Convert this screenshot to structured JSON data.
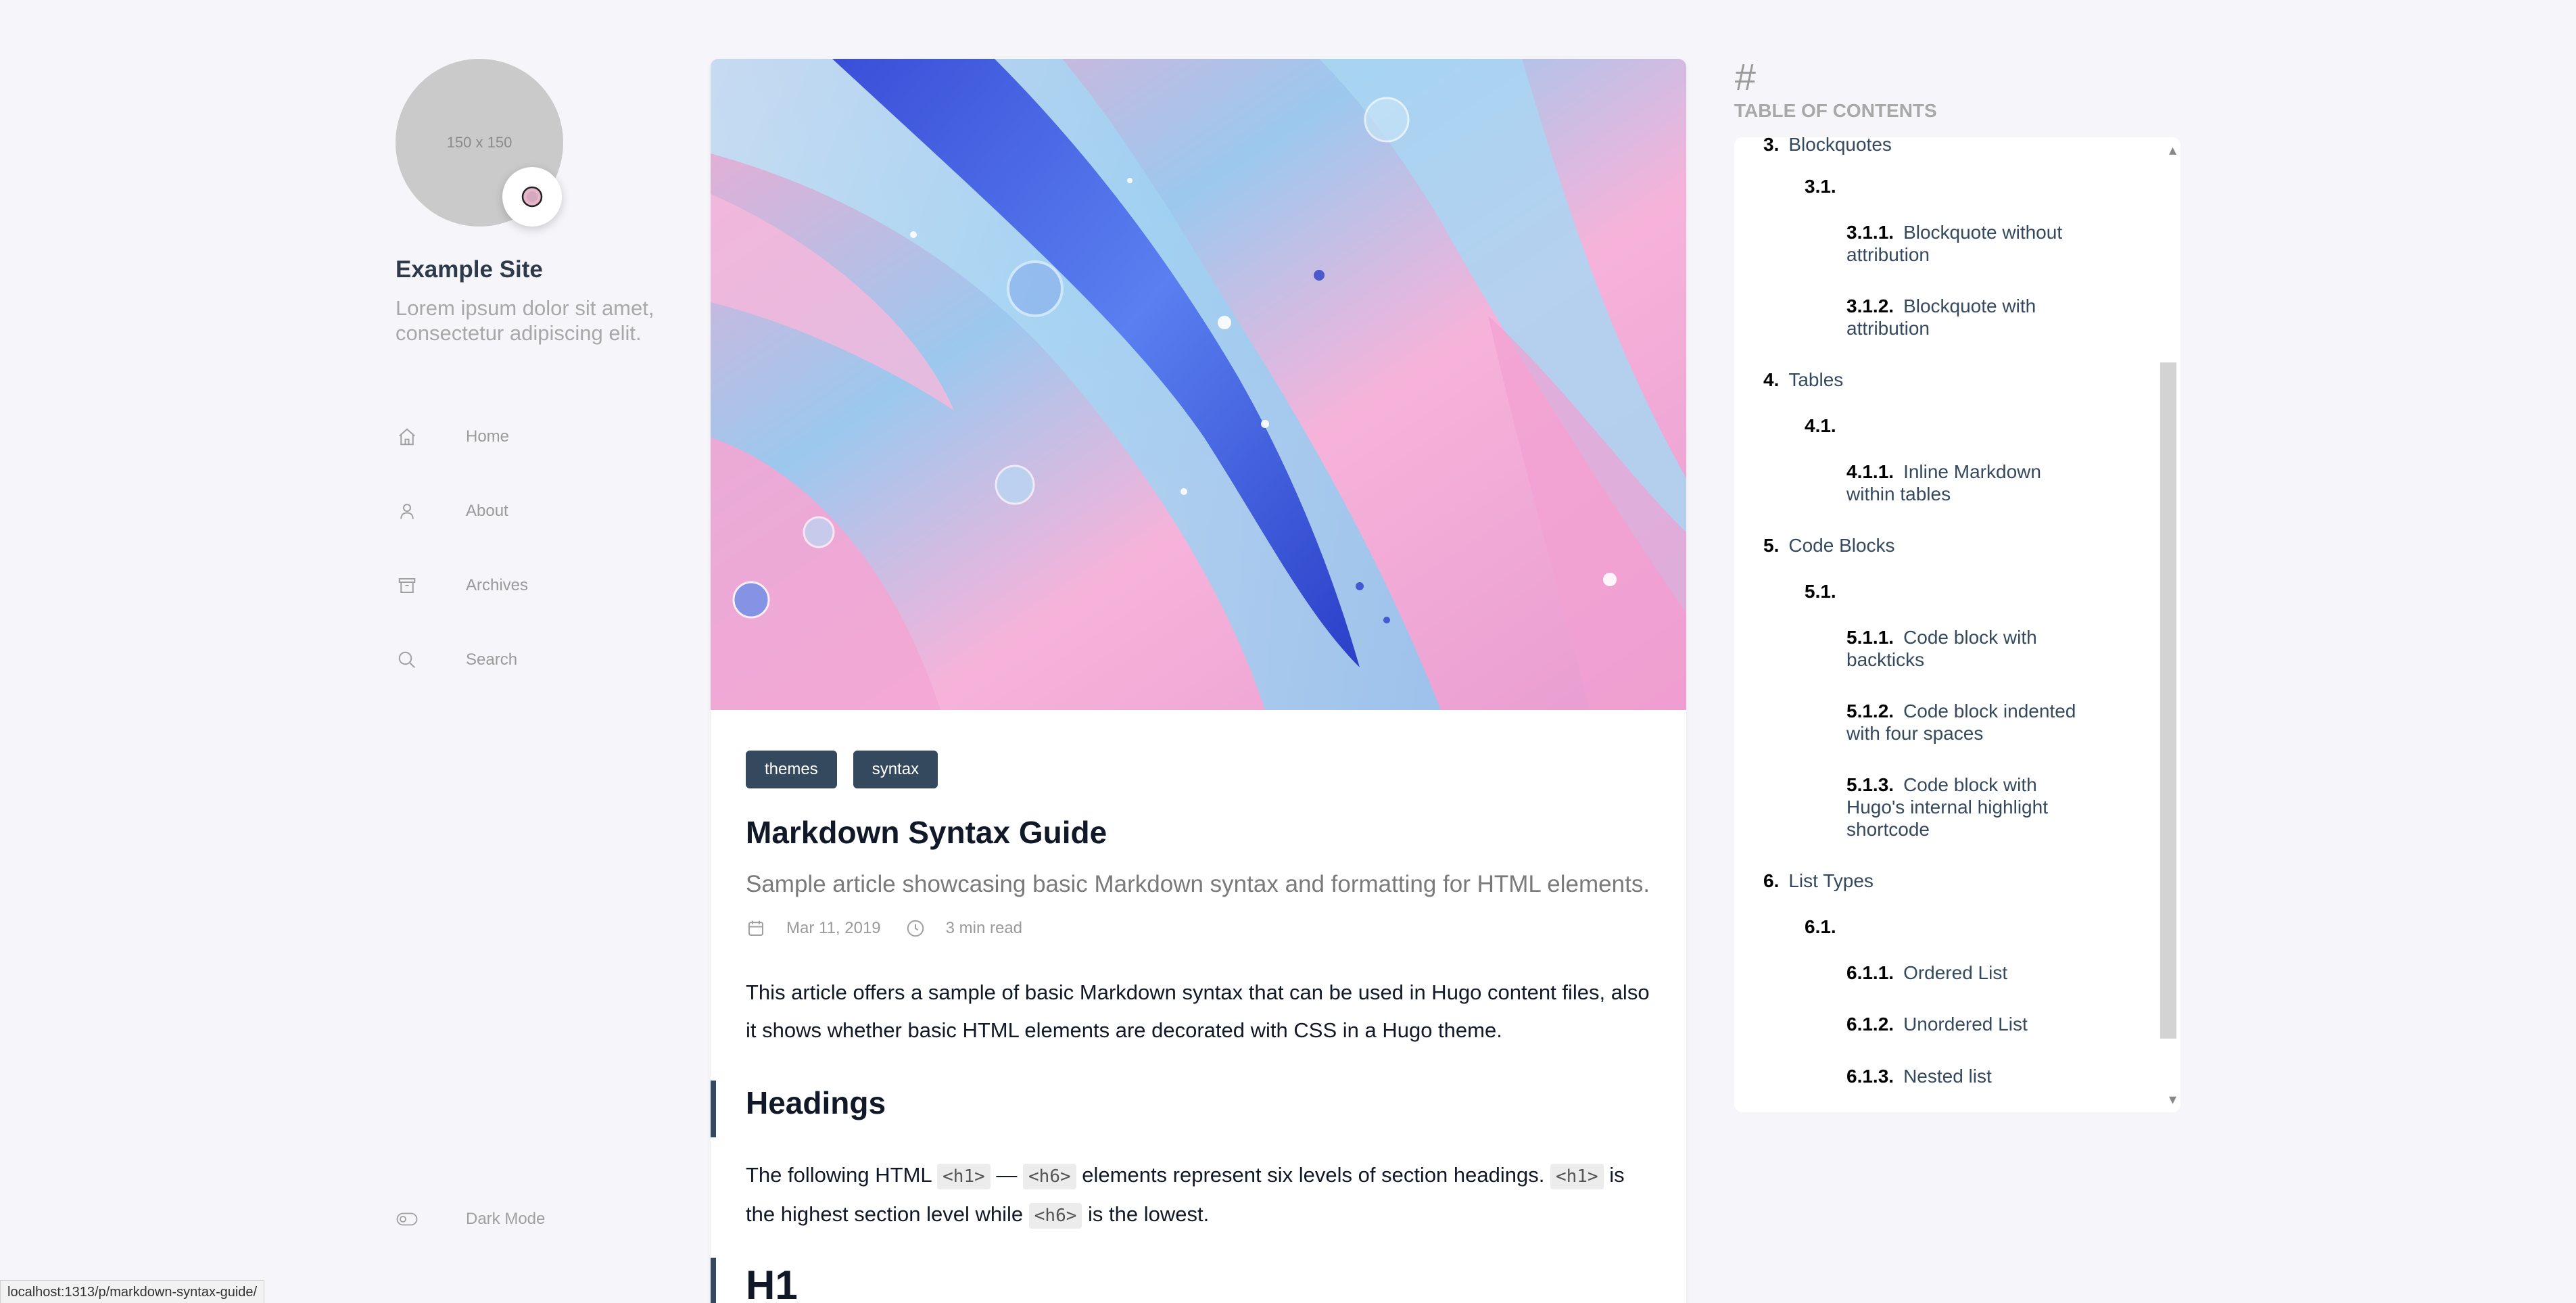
{
  "sidebar": {
    "avatar_placeholder": "150 x 150",
    "site_name": "Example Site",
    "site_description": "Lorem ipsum dolor sit amet, consectetur adipiscing elit.",
    "nav": [
      {
        "label": "Home",
        "icon": "home-icon"
      },
      {
        "label": "About",
        "icon": "user-icon"
      },
      {
        "label": "Archives",
        "icon": "archive-icon"
      },
      {
        "label": "Search",
        "icon": "search-icon"
      }
    ],
    "dark_mode_label": "Dark Mode"
  },
  "article": {
    "tags": [
      "themes",
      "syntax"
    ],
    "title": "Markdown Syntax Guide",
    "subtitle": "Sample article showcasing basic Markdown syntax and formatting for HTML elements.",
    "date": "Mar 11, 2019",
    "read_time": "3 min read",
    "intro": "This article offers a sample of basic Markdown syntax that can be used in Hugo content files, also it shows whether basic HTML elements are decorated with CSS in a Hugo theme.",
    "heading_1": "Headings",
    "headings_text": {
      "p1": "The following HTML",
      "code1": "<h1>",
      "dash": "—",
      "code2": "<h6>",
      "p2": "elements represent six levels of section headings.",
      "code3": "<h1>",
      "p3": "is the highest section level while",
      "code4": "<h6>",
      "p4": "is the lowest."
    },
    "next_heading": "H1"
  },
  "toc": {
    "title": "TABLE OF CONTENTS",
    "hash": "#",
    "items": [
      {
        "num": "3.",
        "text": "Blockquotes"
      },
      {
        "num": "3.1.",
        "text": ""
      },
      {
        "num": "3.1.1.",
        "text": "Blockquote without attribution"
      },
      {
        "num": "3.1.2.",
        "text": "Blockquote with attribution"
      },
      {
        "num": "4.",
        "text": "Tables"
      },
      {
        "num": "4.1.",
        "text": ""
      },
      {
        "num": "4.1.1.",
        "text": "Inline Markdown within tables"
      },
      {
        "num": "5.",
        "text": "Code Blocks"
      },
      {
        "num": "5.1.",
        "text": ""
      },
      {
        "num": "5.1.1.",
        "text": "Code block with backticks"
      },
      {
        "num": "5.1.2.",
        "text": "Code block indented with four spaces"
      },
      {
        "num": "5.1.3.",
        "text": "Code block with Hugo's internal highlight shortcode"
      },
      {
        "num": "6.",
        "text": "List Types"
      },
      {
        "num": "6.1.",
        "text": ""
      },
      {
        "num": "6.1.1.",
        "text": "Ordered List"
      },
      {
        "num": "6.1.2.",
        "text": "Unordered List"
      },
      {
        "num": "6.1.3.",
        "text": "Nested list"
      }
    ]
  },
  "statusbar": {
    "url": "localhost:1313/p/markdown-syntax-guide/"
  },
  "colors": {
    "accent": "#34495e",
    "background": "#f5f5fa",
    "card": "#ffffff"
  }
}
